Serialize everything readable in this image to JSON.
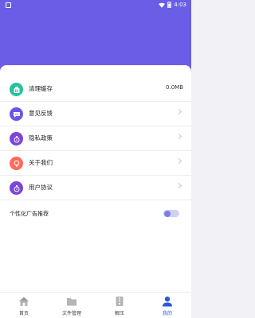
{
  "statusbar": {
    "time": "4:03"
  },
  "settings": {
    "items": [
      {
        "label": "清理缓存",
        "value": "0.0MB",
        "icon": "clean-cache-icon",
        "color": "#24c39f"
      },
      {
        "label": "意见反馈",
        "value": "",
        "icon": "feedback-icon",
        "color": "#6c55e6"
      },
      {
        "label": "隐私政策",
        "value": "",
        "icon": "privacy-icon",
        "color": "#7a45d8"
      },
      {
        "label": "关于我们",
        "value": "",
        "icon": "about-icon",
        "color": "#ff6a5a"
      },
      {
        "label": "用户协议",
        "value": "",
        "icon": "agreement-icon",
        "color": "#7a45d8"
      }
    ],
    "ads_toggle": {
      "label": "个性化广告推荐",
      "on": false
    }
  },
  "tabbar": {
    "tabs": [
      {
        "label": "首页",
        "icon": "home-icon"
      },
      {
        "label": "文件管理",
        "icon": "folder-icon"
      },
      {
        "label": "解压",
        "icon": "zip-icon"
      },
      {
        "label": "我的",
        "icon": "profile-icon",
        "active": true
      }
    ]
  },
  "colors": {
    "hero": "#6a5ee6",
    "accent": "#2c5ad6"
  }
}
